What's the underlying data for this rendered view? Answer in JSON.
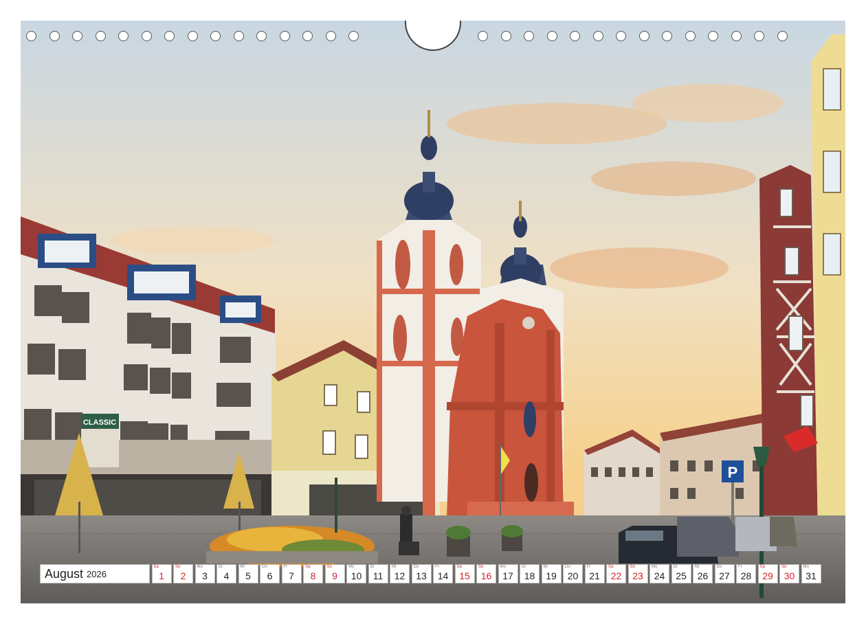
{
  "calendar": {
    "month": "August",
    "year": "2026",
    "days": [
      {
        "wd": "Sa",
        "n": "1",
        "we": true
      },
      {
        "wd": "So",
        "n": "2",
        "we": true
      },
      {
        "wd": "Mo",
        "n": "3",
        "we": false
      },
      {
        "wd": "Di",
        "n": "4",
        "we": false
      },
      {
        "wd": "Mi",
        "n": "5",
        "we": false
      },
      {
        "wd": "Do",
        "n": "6",
        "we": false
      },
      {
        "wd": "Fr",
        "n": "7",
        "we": false
      },
      {
        "wd": "Sa",
        "n": "8",
        "we": true
      },
      {
        "wd": "So",
        "n": "9",
        "we": true
      },
      {
        "wd": "Mo",
        "n": "10",
        "we": false
      },
      {
        "wd": "Di",
        "n": "11",
        "we": false
      },
      {
        "wd": "Mi",
        "n": "12",
        "we": false
      },
      {
        "wd": "Do",
        "n": "13",
        "we": false
      },
      {
        "wd": "Fr",
        "n": "14",
        "we": false
      },
      {
        "wd": "Sa",
        "n": "15",
        "we": true
      },
      {
        "wd": "So",
        "n": "16",
        "we": true
      },
      {
        "wd": "Mo",
        "n": "17",
        "we": false
      },
      {
        "wd": "Di",
        "n": "18",
        "we": false
      },
      {
        "wd": "Mi",
        "n": "19",
        "we": false
      },
      {
        "wd": "Do",
        "n": "20",
        "we": false
      },
      {
        "wd": "Fr",
        "n": "21",
        "we": false
      },
      {
        "wd": "Sa",
        "n": "22",
        "we": true
      },
      {
        "wd": "So",
        "n": "23",
        "we": true
      },
      {
        "wd": "Mo",
        "n": "24",
        "we": false
      },
      {
        "wd": "Di",
        "n": "25",
        "we": false
      },
      {
        "wd": "Mi",
        "n": "26",
        "we": false
      },
      {
        "wd": "Do",
        "n": "27",
        "we": false
      },
      {
        "wd": "Fr",
        "n": "28",
        "we": false
      },
      {
        "wd": "Sa",
        "n": "29",
        "we": true
      },
      {
        "wd": "So",
        "n": "30",
        "we": true
      },
      {
        "wd": "Mo",
        "n": "31",
        "we": false
      }
    ]
  },
  "signs": {
    "classic": "CLASSIC",
    "parking": "P"
  },
  "colors": {
    "weekend": "#d2232a",
    "church": "#c8553c",
    "sky_top": "#c9d7e2",
    "sky_bottom": "#f3c98a"
  }
}
